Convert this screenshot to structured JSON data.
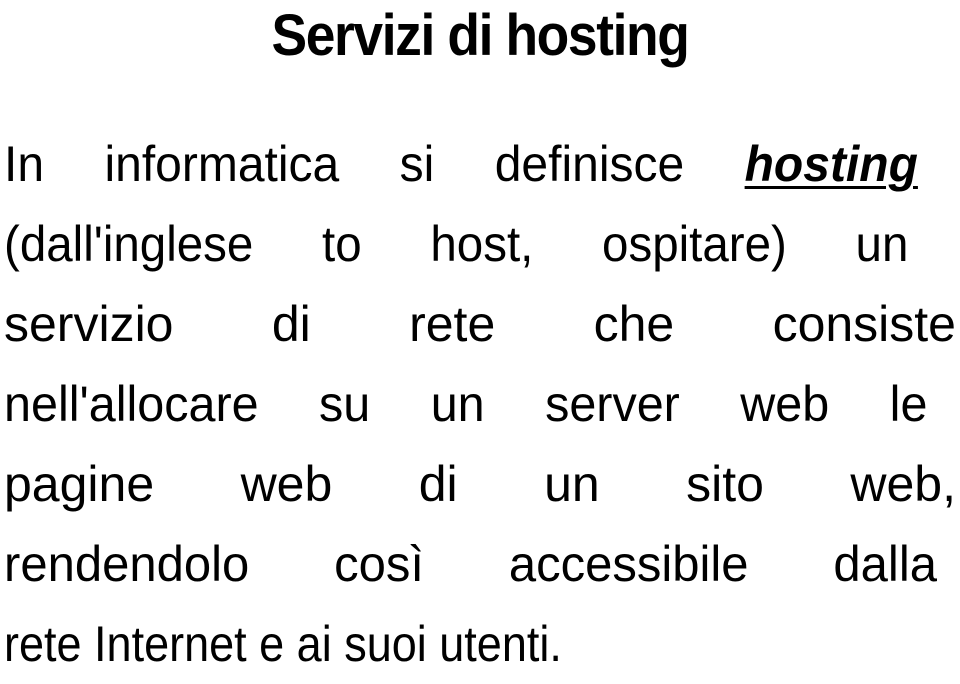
{
  "slide": {
    "title": "Servizi di hosting",
    "paragraph": {
      "lines": [
        {
          "before": "In informatica si definisce ",
          "emphasis": "hosting"
        },
        {
          "text": "(dall'inglese to host, ospitare) un"
        },
        {
          "text": "servizio di rete che consiste"
        },
        {
          "text": "nell'allocare su un server web le"
        },
        {
          "text": "pagine web di un sito web,"
        },
        {
          "text": "rendendolo così accessibile dalla"
        },
        {
          "text": "rete Internet e ai suoi utenti."
        }
      ]
    }
  }
}
